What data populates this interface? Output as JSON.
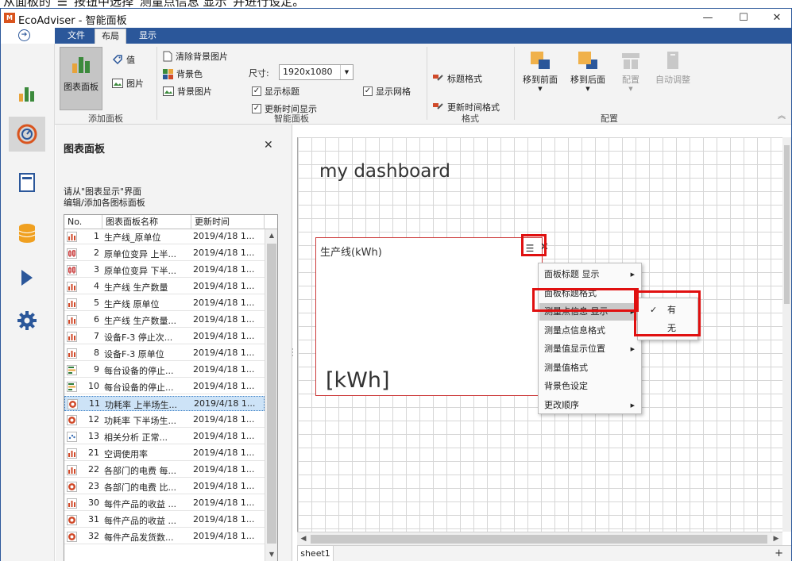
{
  "window": {
    "app_icon_text": "M",
    "title": "EcoAdviser - 智能面板",
    "minimize": "—",
    "maximize": "☐",
    "close": "✕"
  },
  "ribbon": {
    "tabs": [
      {
        "label": "文件"
      },
      {
        "label": "布局"
      },
      {
        "label": "显示"
      }
    ],
    "add_panel_group": {
      "label": "添加面板",
      "chart_panel": "图表面板",
      "value": "值",
      "image": "图片"
    },
    "smart_panel_group": {
      "label": "智能面板",
      "clear_bg_image": "清除背景图片",
      "bg_color": "背景色",
      "bg_image": "背景图片",
      "size_label": "尺寸:",
      "size_value": "1920x1080",
      "show_title": "显示标题",
      "show_update_time": "更新时间显示",
      "show_grid": "显示网格"
    },
    "format_group": {
      "label": "格式",
      "title_format": "标题格式",
      "update_time_format": "更新时间格式"
    },
    "layout_group": {
      "label": "配置",
      "bring_front": "移到前面",
      "send_back": "移到后面",
      "arrange": "配置",
      "auto_adjust": "自动调整"
    },
    "collapse": "︽"
  },
  "panel": {
    "title": "图表面板",
    "close": "✕",
    "hint_line1": "请从\"图表显示\"界面",
    "hint_line2": "编辑/添加各图标面板",
    "columns": {
      "no": "No.",
      "name": "图表面板名称",
      "time": "更新时间"
    },
    "rows": [
      {
        "no": "1",
        "name": "生产线_原单位",
        "time": "2019/4/18 1...",
        "icon": "bar",
        "color": "#d04a2a"
      },
      {
        "no": "2",
        "name": "原单位变异 上半...",
        "time": "2019/4/18 1...",
        "icon": "box",
        "color": "#c53030"
      },
      {
        "no": "3",
        "name": "原单位变异 下半...",
        "time": "2019/4/18 1...",
        "icon": "box",
        "color": "#c53030"
      },
      {
        "no": "4",
        "name": "生产线 生产数量",
        "time": "2019/4/18 1...",
        "icon": "bar",
        "color": "#d04a2a"
      },
      {
        "no": "5",
        "name": "生产线 原单位",
        "time": "2019/4/18 1...",
        "icon": "bar",
        "color": "#d04a2a"
      },
      {
        "no": "6",
        "name": "生产线 生产数量...",
        "time": "2019/4/18 1...",
        "icon": "bar",
        "color": "#d04a2a"
      },
      {
        "no": "7",
        "name": "设备F-3 停止次...",
        "time": "2019/4/18 1...",
        "icon": "bar",
        "color": "#d04a2a"
      },
      {
        "no": "8",
        "name": "设备F-3 原单位",
        "time": "2019/4/18 1...",
        "icon": "bar",
        "color": "#d04a2a"
      },
      {
        "no": "9",
        "name": "每台设备的停止...",
        "time": "2019/4/18 1...",
        "icon": "hbar",
        "color": "#2f7d3a"
      },
      {
        "no": "10",
        "name": "每台设备的停止...",
        "time": "2019/4/18 1...",
        "icon": "hbar",
        "color": "#2f7d3a"
      },
      {
        "no": "11",
        "name": "功耗率 上半场生...",
        "time": "2019/4/18 1...",
        "icon": "gauge",
        "color": "#d04a2a",
        "selected": true
      },
      {
        "no": "12",
        "name": "功耗率 下半场生...",
        "time": "2019/4/18 1...",
        "icon": "gauge",
        "color": "#d04a2a"
      },
      {
        "no": "13",
        "name": "相关分析   正常...",
        "time": "2019/4/18 1...",
        "icon": "scatter",
        "color": "#3a6fb5"
      },
      {
        "no": "21",
        "name": "空调使用率",
        "time": "2019/4/18 1...",
        "icon": "bar",
        "color": "#d04a2a"
      },
      {
        "no": "22",
        "name": "各部门的电费 每...",
        "time": "2019/4/18 1...",
        "icon": "bar",
        "color": "#d04a2a"
      },
      {
        "no": "23",
        "name": "各部门的电费 比...",
        "time": "2019/4/18 1...",
        "icon": "gauge",
        "color": "#d04a2a"
      },
      {
        "no": "30",
        "name": "每件产品的收益 ...",
        "time": "2019/4/18 1...",
        "icon": "bar",
        "color": "#d04a2a"
      },
      {
        "no": "31",
        "name": "每件产品的收益 ...",
        "time": "2019/4/18 1...",
        "icon": "gauge",
        "color": "#d04a2a"
      },
      {
        "no": "32",
        "name": "每件产品发货数...",
        "time": "2019/4/18 1...",
        "icon": "gauge",
        "color": "#d04a2a"
      }
    ]
  },
  "dashboard": {
    "title": "my dashboard",
    "card": {
      "label": "生产线(kWh)",
      "unit": "[kWh]",
      "menu_icon": "☰",
      "close": "✕"
    }
  },
  "context_menu": {
    "items": [
      {
        "label": "面板标题 显示",
        "has_sub": true
      },
      {
        "label": "面板标题格式",
        "has_sub": false
      },
      {
        "label": "测量点信息  显示",
        "has_sub": true,
        "highlighted": true
      },
      {
        "label": "测量点信息格式",
        "has_sub": false
      },
      {
        "label": "测量值显示位置",
        "has_sub": true
      },
      {
        "label": "测量值格式",
        "has_sub": false
      },
      {
        "label": "背景色设定",
        "has_sub": false
      },
      {
        "label": "更改顺序",
        "has_sub": true
      }
    ],
    "submenu": [
      {
        "label": "有",
        "checked": true
      },
      {
        "label": "无",
        "checked": false
      }
    ]
  },
  "sheets": {
    "tabs": [
      "sheet1"
    ],
    "add": "+"
  },
  "colors": {
    "accent": "#2b579a",
    "highlight_box": "#e01010",
    "card_border": "#cc3b3b"
  }
}
